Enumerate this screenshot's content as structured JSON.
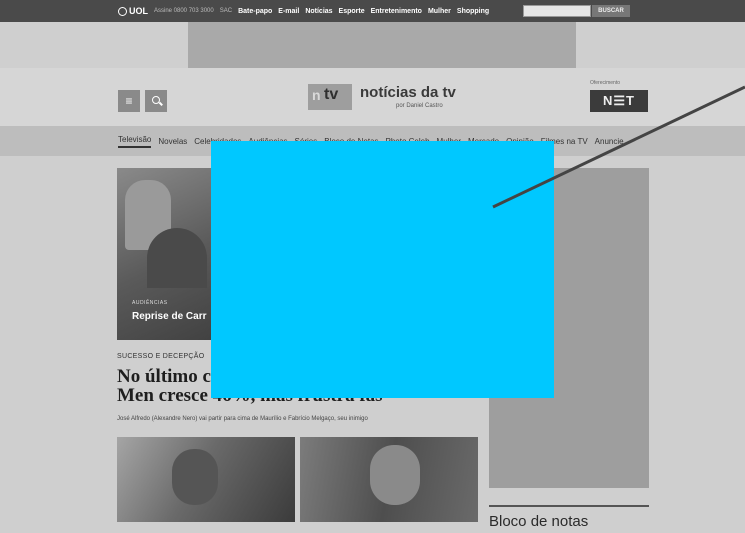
{
  "topbar": {
    "logo": "UOL",
    "subscribe": "Assine 0800 703 3000",
    "sac": "SAC",
    "links": [
      "Bate-papo",
      "E-mail",
      "Notícias",
      "Esporte",
      "Entretenimento",
      "Mulher",
      "Shopping"
    ],
    "search_placeholder": "",
    "search_button": "BUSCAR"
  },
  "header": {
    "logo_n": "n",
    "logo_tv": "tv",
    "site_title": "notícias da tv",
    "byline": "por Daniel Castro",
    "sponsor_label": "Oferecimento",
    "sponsor_logo": "N☰T"
  },
  "nav": {
    "items": [
      "Televisão",
      "Novelas",
      "Celebridades",
      "Audiências",
      "Séries",
      "Bloco de Notas",
      "Photo Celeb",
      "Mulher",
      "Mercado",
      "Opinião",
      "Filmes na TV",
      "Anuncie"
    ]
  },
  "hero": {
    "tag": "AUDIÊNCIAS",
    "title": "Reprise de Carr"
  },
  "article": {
    "section_tag": "SUCESSO E DECEPÇÃO",
    "headline_line1": "No último c",
    "headline_line2": "Men cresce 46%, mas frustra fãs",
    "summary": "José Alfredo (Alexandre Nero) vai partir para cima de Maurílio e Fabrício Melgaço, seu inimigo"
  },
  "sidebar": {
    "bloco_title": "Bloco de notas"
  },
  "colors": {
    "highlight_box": "#00c8ff",
    "pointer_line": "#444444"
  },
  "icons": [
    "menu-icon",
    "search-icon"
  ]
}
